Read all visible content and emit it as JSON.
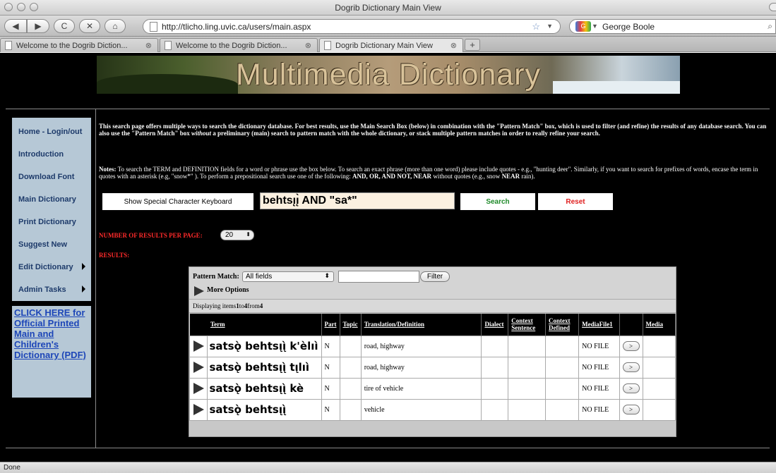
{
  "window": {
    "title": "Dogrib Dictionary Main View"
  },
  "toolbar": {
    "back_icon": "◀",
    "forward_icon": "▶",
    "reload_icon": "C",
    "stop_icon": "✕",
    "home_icon": "⌂",
    "url": "http://tlicho.ling.uvic.ca/users/main.aspx",
    "search_engine_label": "G",
    "search_value": "George Boole"
  },
  "tabs": [
    {
      "label": "Welcome to the Dogrib Diction..."
    },
    {
      "label": "Welcome to the Dogrib Diction..."
    },
    {
      "label": "Dogrib Dictionary Main View"
    }
  ],
  "banner": {
    "title": "Multimedia Dictionary"
  },
  "sidebar": {
    "items": [
      {
        "label": "Home - Login/out"
      },
      {
        "label": "Introduction"
      },
      {
        "label": "Download Font"
      },
      {
        "label": "Main Dictionary"
      },
      {
        "label": "Print Dictionary"
      },
      {
        "label": "Suggest New"
      },
      {
        "label": "Edit Dictionary"
      },
      {
        "label": "Admin Tasks"
      }
    ],
    "pdf_link": "CLICK HERE for Official Printed Main and Children's Dictionary (PDF)"
  },
  "intro": {
    "part1": "This search page offers multiple ways to search the dictionary database. For best results, use the Main Search Box (below) in combination with the \"Pattern Match\" box, which is used to filter (and refine) the results of any database search. You can also use the \"Pattern Match\" box ",
    "italic": "without",
    "part2": " a preliminary (main) search to pattern match with the whole dictionary, or stack multiple pattern matches in order to really refine your search."
  },
  "notes": {
    "label": "Notes:",
    "text1": " To search the TERM and DEFINITION fields for a word or phrase use the box below. To search an exact phrase (more than one word) please include quotes - e.g., \"hunting deer\". Similarly, if you want to search for prefixes of words, encase the term in quotes with an asterisk (e.g, \"snow*\" ). To perform a prepositional search use one of the following: ",
    "operators": "AND, OR, AND NOT, NEAR",
    "text2": " without quotes (e.g., snow ",
    "near": "NEAR",
    "text3": " rain)."
  },
  "search": {
    "special_chars_button": "Show Special Character Keyboard",
    "query": "behtsı̨ı̨̀ AND \"sa*\"",
    "search_button": "Search",
    "reset_button": "Reset"
  },
  "results": {
    "per_page_label": "NUMBER OF RESULTS PER PAGE:",
    "per_page_value": "20",
    "results_label": "RESULTS:",
    "pattern_match_label": "Pattern Match:",
    "pattern_match_value": "All fields",
    "filter_button": "Filter",
    "more_options": "More Options",
    "count_prefix": "Displaying items ",
    "count_from": "1",
    "count_to_word": " to ",
    "count_to": "4",
    "count_of_word": " from ",
    "count_total": "4",
    "columns": [
      "Term",
      "Part",
      "Topic",
      "Translation/Definition",
      "Dialect",
      "Context Sentence",
      "Context Defined",
      "MediaFile1",
      "",
      "Media"
    ],
    "rows": [
      {
        "term": "satsǫ̀ behtsı̨ı̨̀ k'èlıì",
        "part": "N",
        "topic": "",
        "definition": "road, highway",
        "dialect": "",
        "context_sentence": "",
        "context_defined": "",
        "media_file": "NO FILE",
        "go": ">",
        "media": ""
      },
      {
        "term": "satsǫ̀ behtsı̨ı̨̀ tı̨lıì",
        "part": "N",
        "topic": "",
        "definition": "road, highway",
        "dialect": "",
        "context_sentence": "",
        "context_defined": "",
        "media_file": "NO FILE",
        "go": ">",
        "media": ""
      },
      {
        "term": "satsǫ̀ behtsı̨ı̨̀ kè",
        "part": "N",
        "topic": "",
        "definition": "tire of vehicle",
        "dialect": "",
        "context_sentence": "",
        "context_defined": "",
        "media_file": "NO FILE",
        "go": ">",
        "media": ""
      },
      {
        "term": "satsǫ̀ behtsı̨ı̨̀",
        "part": "N",
        "topic": "",
        "definition": "vehicle",
        "dialect": "",
        "context_sentence": "",
        "context_defined": "",
        "media_file": "NO FILE",
        "go": ">",
        "media": ""
      }
    ]
  },
  "status": {
    "text": "Done"
  }
}
